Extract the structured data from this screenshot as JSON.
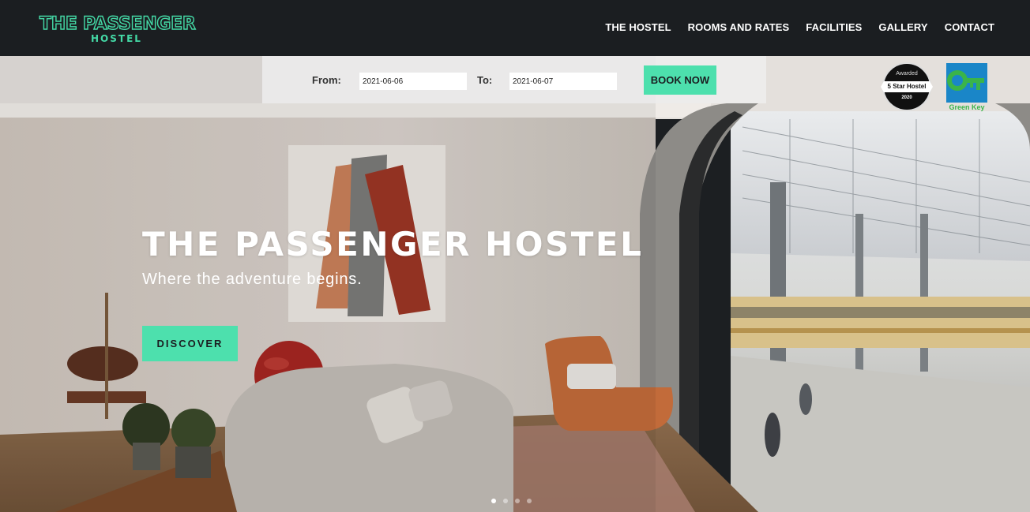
{
  "logo": {
    "main": "THE PASSENGER",
    "sub": "HOSTEL"
  },
  "nav": {
    "items": [
      {
        "label": "THE HOSTEL"
      },
      {
        "label": "ROOMS AND RATES"
      },
      {
        "label": "FACILITIES"
      },
      {
        "label": "GALLERY"
      },
      {
        "label": "CONTACT"
      }
    ]
  },
  "booking": {
    "from_label": "From:",
    "from_value": "2021-06-06",
    "to_label": "To:",
    "to_value": "2021-06-07",
    "book_label": "BOOK NOW"
  },
  "badges": {
    "star": {
      "awarded": "Awarded",
      "title": "5 Star Hostel",
      "year": "2020"
    },
    "green_key": {
      "label": "Green Key"
    }
  },
  "hero": {
    "title": "THE PASSENGER HOSTEL",
    "subtitle": "Where the adventure begins.",
    "cta": "DISCOVER"
  },
  "slider": {
    "active": 1,
    "count": 4
  },
  "colors": {
    "accent": "#4de0ad",
    "topbar": "#1b1e21",
    "logo": "#44d9a6",
    "badge_blue": "#1a86c8"
  }
}
